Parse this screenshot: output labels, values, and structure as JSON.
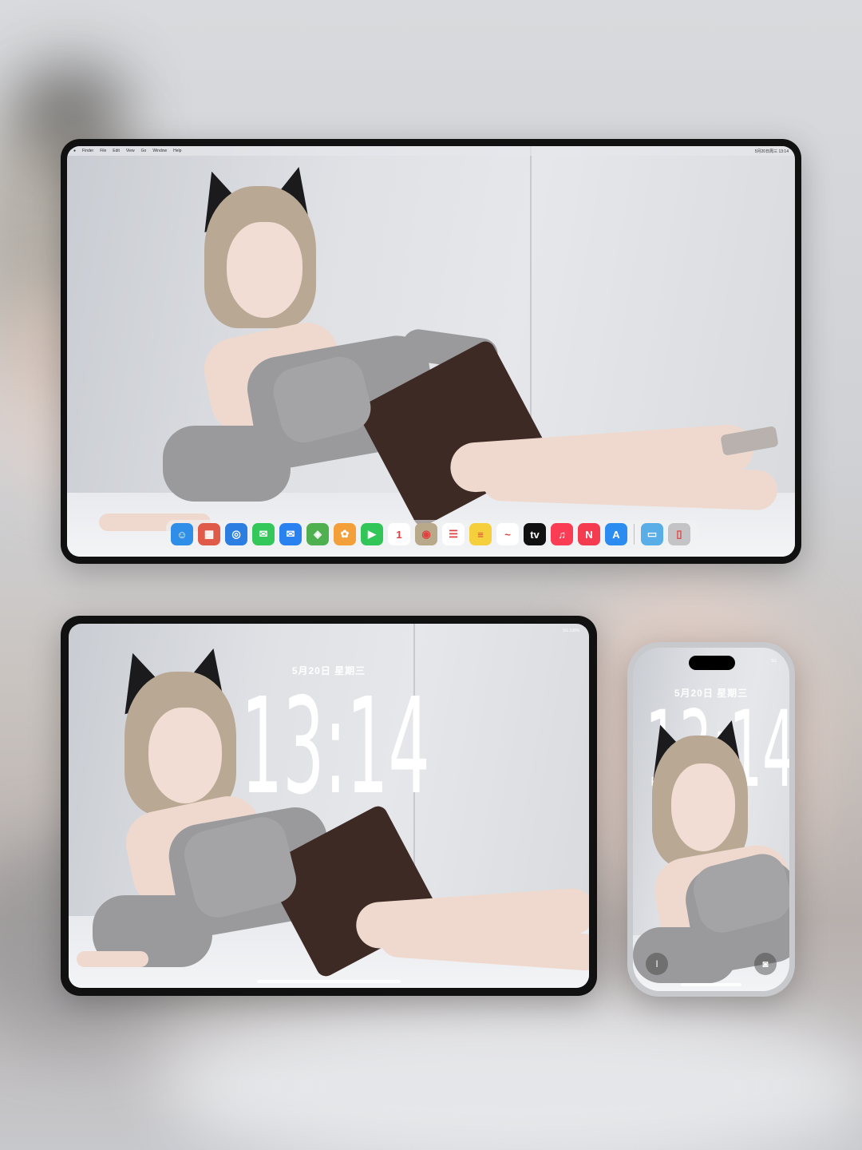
{
  "mac": {
    "menubar": {
      "apple": "●",
      "items": [
        "Finder",
        "File",
        "Edit",
        "View",
        "Go",
        "Window",
        "Help"
      ],
      "clock": "5月20日周三 13:14"
    },
    "dock": [
      {
        "name": "finder-icon",
        "glyph": "☺",
        "color": "#2f8fe8"
      },
      {
        "name": "launchpad-icon",
        "glyph": "▦",
        "color": "#e05a4a"
      },
      {
        "name": "safari-icon",
        "glyph": "◎",
        "color": "#2c7fe0"
      },
      {
        "name": "messages-icon",
        "glyph": "✉",
        "color": "#34c759"
      },
      {
        "name": "mail-icon",
        "glyph": "✉",
        "color": "#2a82f0"
      },
      {
        "name": "maps-icon",
        "glyph": "◈",
        "color": "#4fb04f"
      },
      {
        "name": "photos-icon",
        "glyph": "✿",
        "color": "#f3a03a"
      },
      {
        "name": "facetime-icon",
        "glyph": "▶",
        "color": "#32c659"
      },
      {
        "name": "calendar-icon",
        "glyph": "1",
        "color": "#ffffff"
      },
      {
        "name": "contacts-icon",
        "glyph": "◉",
        "color": "#b8a98a"
      },
      {
        "name": "reminders-icon",
        "glyph": "☰",
        "color": "#ffffff"
      },
      {
        "name": "notes-icon",
        "glyph": "≡",
        "color": "#f5d03c"
      },
      {
        "name": "freeform-icon",
        "glyph": "~",
        "color": "#ffffff"
      },
      {
        "name": "tv-icon",
        "glyph": "tv",
        "color": "#111111"
      },
      {
        "name": "music-icon",
        "glyph": "♫",
        "color": "#fa3c54"
      },
      {
        "name": "news-icon",
        "glyph": "N",
        "color": "#f53b4f"
      },
      {
        "name": "app-store-icon",
        "glyph": "A",
        "color": "#2d8cf0"
      },
      {
        "name": "downloads-folder-icon",
        "glyph": "▭",
        "color": "#5aaee8"
      },
      {
        "name": "trash-icon",
        "glyph": "▯",
        "color": "#c4c4c6"
      }
    ]
  },
  "ipad": {
    "status": "5G 100%",
    "date": "5月20日 星期三",
    "time": "13:14"
  },
  "iphone": {
    "status": "5G",
    "date": "5月20日 星期三",
    "time": "13:14",
    "flashlight_glyph": "ǀ",
    "camera_glyph": "◙"
  }
}
